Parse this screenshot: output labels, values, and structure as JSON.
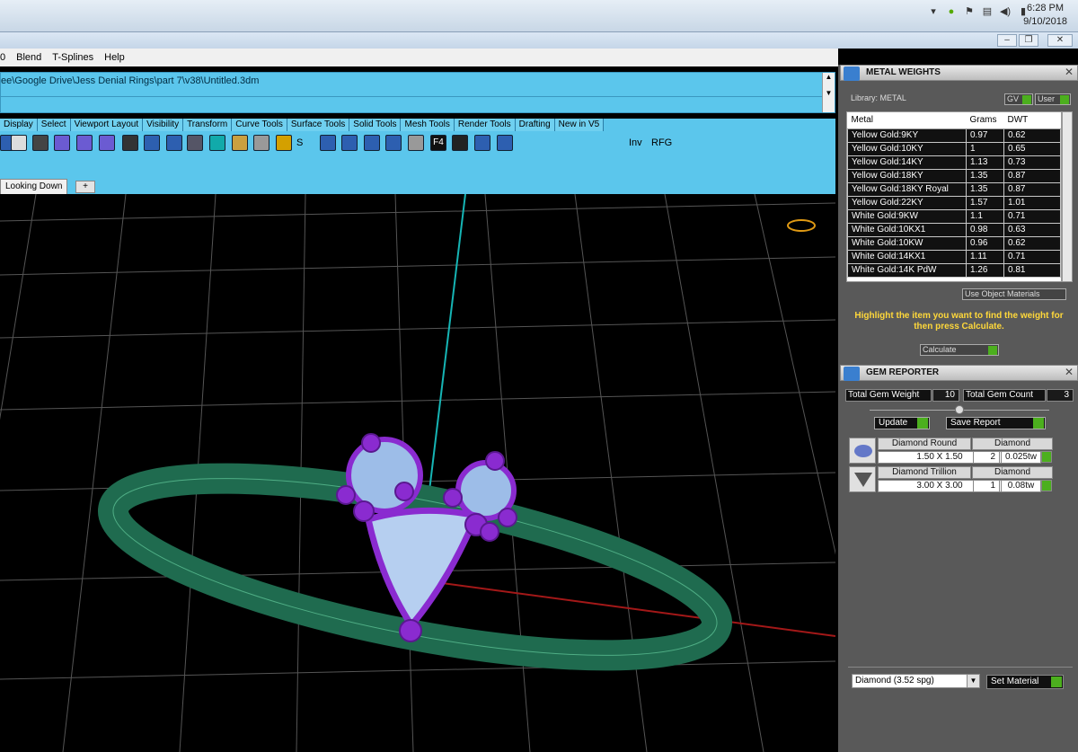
{
  "taskbar": {
    "time": "6:28 PM",
    "date": "9/10/2018"
  },
  "menu": {
    "items": [
      "0",
      "Blend",
      "T-Splines",
      "Help"
    ]
  },
  "command": {
    "path": "ee\\Google Drive\\Jess Denial Rings\\part 7\\v38\\Untitled.3dm"
  },
  "toolbar_tabs": [
    "Display",
    "Select",
    "Viewport Layout",
    "Visibility",
    "Transform",
    "Curve Tools",
    "Surface Tools",
    "Solid Tools",
    "Mesh Tools",
    "Render Tools",
    "Drafting",
    "New in V5"
  ],
  "toolbar_text": {
    "s": "S",
    "inv": "Inv",
    "rfg": "RFG",
    "f4": "F4"
  },
  "viewport": {
    "tab": "Looking Down",
    "add": "+"
  },
  "metal_weights": {
    "title": "METAL WEIGHTS",
    "library_label": "Library: METAL",
    "gv": "GV",
    "user": "User",
    "columns": [
      "Metal",
      "Grams",
      "DWT"
    ],
    "rows": [
      [
        "Yellow Gold:9KY",
        "0.97",
        "0.62"
      ],
      [
        "Yellow Gold:10KY",
        "1",
        "0.65"
      ],
      [
        "Yellow Gold:14KY",
        "1.13",
        "0.73"
      ],
      [
        "Yellow Gold:18KY",
        "1.35",
        "0.87"
      ],
      [
        "Yellow Gold:18KY Royal",
        "1.35",
        "0.87"
      ],
      [
        "Yellow Gold:22KY",
        "1.57",
        "1.01"
      ],
      [
        "White Gold:9KW",
        "1.1",
        "0.71"
      ],
      [
        "White Gold:10KX1",
        "0.98",
        "0.63"
      ],
      [
        "White Gold:10KW",
        "0.96",
        "0.62"
      ],
      [
        "White Gold:14KX1",
        "1.11",
        "0.71"
      ],
      [
        "White Gold:14K PdW",
        "1.26",
        "0.81"
      ]
    ],
    "use_object_materials": "Use Object Materials",
    "help": "Highlight the item you want to find the weight for then press Calculate.",
    "calculate": "Calculate"
  },
  "gem_reporter": {
    "title": "GEM REPORTER",
    "total_weight_label": "Total Gem Weight",
    "total_weight": "10",
    "total_count_label": "Total Gem Count",
    "total_count": "3",
    "update": "Update",
    "save_report": "Save Report",
    "gems": [
      {
        "shape": "Diamond Round",
        "material": "Diamond",
        "size": "1.50 X 1.50",
        "count": "2",
        "weight": "0.025tw"
      },
      {
        "shape": "Diamond Trillion",
        "material": "Diamond",
        "size": "3.00 X 3.00",
        "count": "1",
        "weight": "0.08tw"
      }
    ],
    "material_select": "Diamond     (3.52 spg)",
    "set_material": "Set Material"
  },
  "colors": {
    "accent": "#5bc6ec",
    "panel": "#595959",
    "ring": "#1f6b4f",
    "setting": "#8a2bd0"
  }
}
